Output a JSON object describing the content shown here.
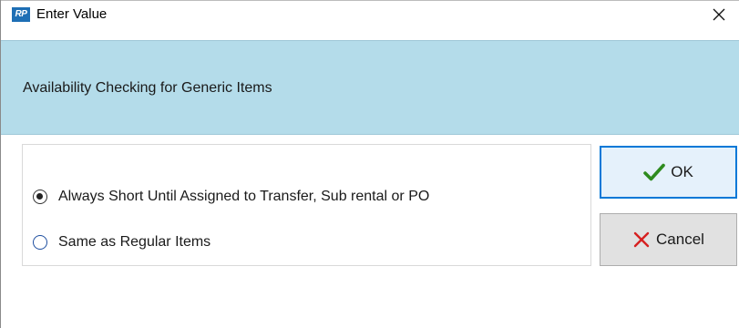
{
  "window": {
    "title": "Enter Value",
    "app_icon_text": "RP",
    "close_glyph": "close-icon"
  },
  "header": {
    "text": "Availability Checking for Generic Items",
    "background": "#b4dcea"
  },
  "options": [
    {
      "label": "Always Short Until Assigned to Transfer, Sub rental or PO",
      "selected": true
    },
    {
      "label": "Same as Regular Items",
      "selected": false
    }
  ],
  "buttons": {
    "ok": {
      "label": "OK",
      "icon": "checkmark-icon",
      "color": "#2e8b1e"
    },
    "cancel": {
      "label": "Cancel",
      "icon": "x-icon",
      "color": "#d62020"
    }
  }
}
